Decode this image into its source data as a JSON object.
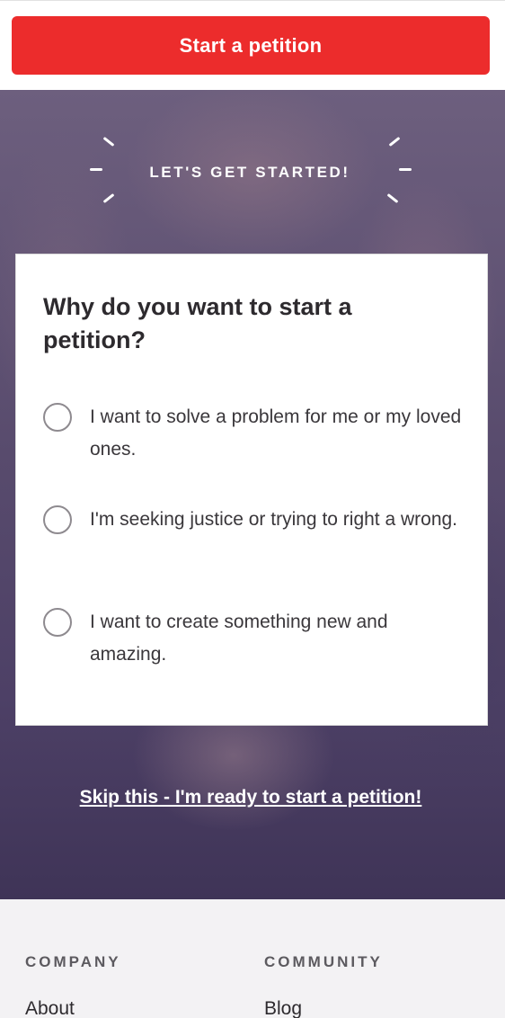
{
  "header": {
    "start_button_label": "Start a petition"
  },
  "hero": {
    "title": "LET'S GET STARTED!",
    "skip_link": "Skip this - I'm ready to start a petition!"
  },
  "survey": {
    "question": "Why do you want to start a petition?",
    "options": [
      {
        "label": "I want to solve a problem for me or my loved ones."
      },
      {
        "label": "I'm seeking justice or trying to right a wrong."
      },
      {
        "label": "I want to create something new and amazing."
      }
    ]
  },
  "footer": {
    "columns": [
      {
        "heading": "COMPANY",
        "first_link": "About"
      },
      {
        "heading": "COMMUNITY",
        "first_link": "Blog"
      }
    ]
  },
  "colors": {
    "accent": "#ec2c2c",
    "hero_overlay": "#584b6d",
    "footer_bg": "#f3f2f4"
  }
}
